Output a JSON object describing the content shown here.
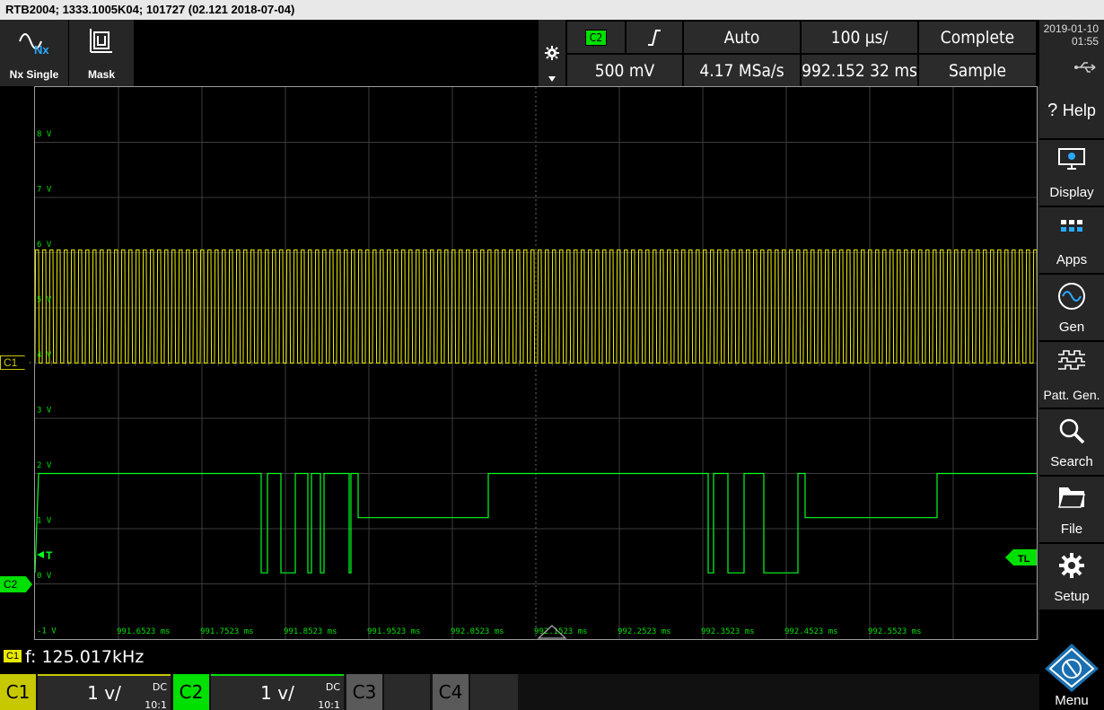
{
  "title_bar": {
    "text": "RTB2004; 1333.1005K04; 101727 (02.121 2018-07-04)"
  },
  "toolbar": {
    "nx_single_label": "Nx Single",
    "nx_icon_text": "Nx",
    "mask_label": "Mask",
    "trigger_source": "C2",
    "trigger_mode": "Auto",
    "timebase": "100 µs/",
    "acq_status": "Complete",
    "trigger_level": "500 mV",
    "sample_rate": "4.17 MSa/s",
    "horizontal_position": "992.152 32 ms",
    "acq_mode": "Sample"
  },
  "datetime": {
    "date": "2019-01-10",
    "time": "01:55"
  },
  "sidebar": {
    "items": [
      {
        "label": "Help",
        "icon": "help-icon"
      },
      {
        "label": "Display",
        "icon": "monitor-icon"
      },
      {
        "label": "Apps",
        "icon": "apps-grid-icon"
      },
      {
        "label": "Gen",
        "icon": "sine-wave-icon"
      },
      {
        "label": "Patt. Gen.",
        "icon": "pattern-icon"
      },
      {
        "label": "Search",
        "icon": "magnifier-icon"
      },
      {
        "label": "File",
        "icon": "folder-icon"
      },
      {
        "label": "Setup",
        "icon": "gear-icon"
      }
    ],
    "menu_label": "Menu"
  },
  "grid": {
    "y_labels": [
      "8 V",
      "7 V",
      "6 V",
      "5 V",
      "4 V",
      "3 V",
      "2 V",
      "1 V",
      "0 V",
      "-1 V"
    ],
    "x_labels": [
      "991.6523 ms",
      "991.7523 ms",
      "991.8523 ms",
      "991.9523 ms",
      "992.0523 ms",
      "992.1523 ms",
      "992.2523 ms",
      "992.3523 ms",
      "992.4523 ms",
      "992.5523 ms"
    ],
    "c1_marker": "C1",
    "c2_marker": "C2",
    "trigger_marker": "T",
    "trigger_level_marker": "TL"
  },
  "measurement": {
    "source": "C1",
    "text": "f: 125.017kHz"
  },
  "channels": [
    {
      "id": "C1",
      "scale": "1 v/",
      "coupling": "DC",
      "probe": "10:1",
      "color": "#c8c800"
    },
    {
      "id": "C2",
      "scale": "1 v/",
      "coupling": "DC",
      "probe": "10:1",
      "color": "#00e000"
    },
    {
      "id": "C3",
      "color": "#5a5a5a"
    },
    {
      "id": "C4",
      "color": "#5a5a5a"
    }
  ],
  "colors": {
    "c1_trace": "#f0f000",
    "c2_trace": "#00ff20",
    "grid": "#3c3c3c"
  }
}
